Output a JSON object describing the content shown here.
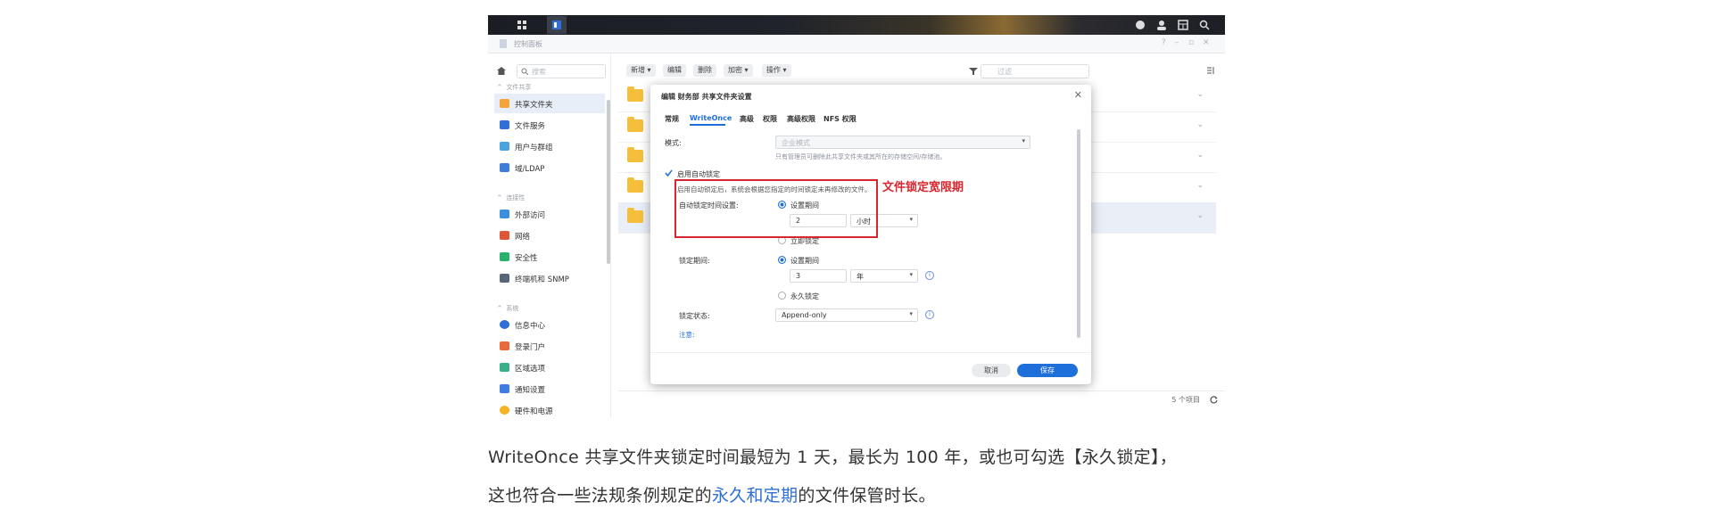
{
  "window": {
    "title": "控制面板"
  },
  "sidebar": {
    "search_placeholder": "搜索",
    "sections": [
      {
        "label": "文件共享",
        "items": [
          "共享文件夹",
          "文件服务",
          "用户与群组",
          "域/LDAP"
        ]
      },
      {
        "label": "连接性",
        "items": [
          "外部访问",
          "网络",
          "安全性",
          "终端机和 SNMP"
        ]
      },
      {
        "label": "系统",
        "items": [
          "信息中心",
          "登录门户",
          "区域选项",
          "通知设置",
          "硬件和电源"
        ]
      }
    ]
  },
  "toolbar": {
    "create": "新增 ▾",
    "edit": "编辑",
    "delete": "删除",
    "encrypt": "加密 ▾",
    "action": "操作 ▾",
    "filter_placeholder": "过滤"
  },
  "list": {
    "item_count": "5 个项目"
  },
  "dialog": {
    "title": "编辑 财务部 共享文件夹设置",
    "tabs": [
      "常规",
      "WriteOnce",
      "高级",
      "权限",
      "高级权限",
      "NFS 权限"
    ],
    "mode_label": "模式:",
    "mode_value": "企业模式",
    "mode_hint": "只有管理员可删除此共享文件夹或其所在的存储空间/存储池。",
    "auto_lock_label": "启用自动锁定",
    "auto_lock_hint": "启用自动锁定后，系统会根据您指定的时间锁定未再修改的文件。",
    "auto_lock_time_label": "自动锁定时间设置:",
    "set_period": "设置期间",
    "auto_lock_value": "2",
    "auto_lock_unit": "小时",
    "lock_now": "立即锁定",
    "lock_period_label": "锁定期间:",
    "lock_period_value": "3",
    "lock_period_unit": "年",
    "permanent_lock": "永久锁定",
    "lock_state_label": "锁定状态:",
    "lock_state_value": "Append-only",
    "note_label": "注意:",
    "cancel": "取消",
    "save": "保存"
  },
  "annotation": {
    "label": "文件锁定宽限期",
    "color": "#d7262e"
  },
  "article": {
    "line1": "WriteOnce 共享文件夹锁定时间最短为 1 天，最长为 100 年，或也可勾选【永久锁定】，",
    "line2_before": "这也符合一些法规条例规定的",
    "line2_link": "永久和定期",
    "line2_after": "的文件保管时长。"
  },
  "colors": {
    "accent": "#1e6fd9",
    "link": "#2f6fd6",
    "folder": "#f6bf3a"
  }
}
